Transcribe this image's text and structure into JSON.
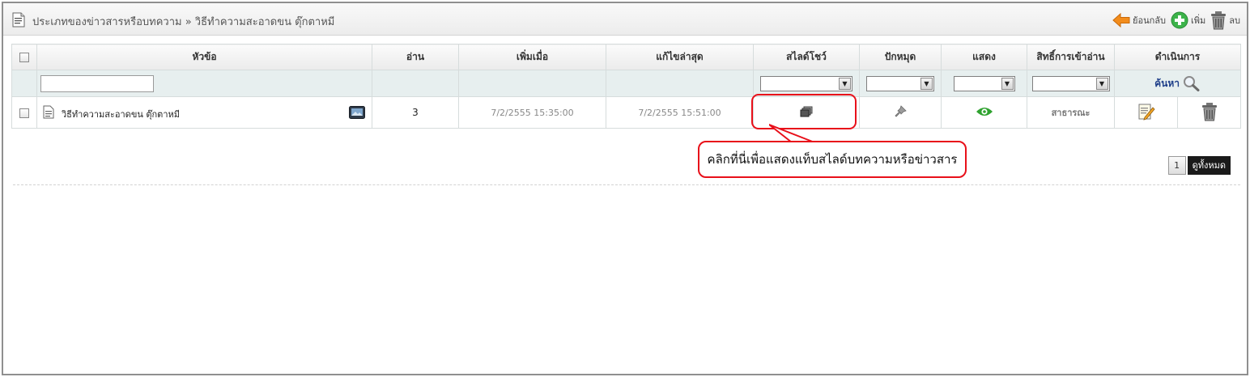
{
  "header": {
    "title": "ประเภทของข่าวสารหรือบทความ » วิธีทำความสะอาดขน ตุ๊กตาหมี",
    "back_label": "ย้อนกลับ",
    "add_label": "เพิ่ม",
    "delete_label": "ลบ"
  },
  "table": {
    "columns": [
      "หัวข้อ",
      "อ่าน",
      "เพิ่มเมื่อ",
      "แก้ไขล่าสุด",
      "สไลด์โชว์",
      "ปักหมุด",
      "แสดง",
      "สิทธิ์การเข้าอ่าน",
      "ดำเนินการ"
    ],
    "filter": {
      "title_value": "",
      "slideshow_value": "",
      "pin_value": "",
      "show_value": "",
      "access_value": "",
      "search_label": "ค้นหา"
    },
    "rows": [
      {
        "title": "วิธีทำความสะอาดขน ตุ๊กตาหมี",
        "reads": "3",
        "added": "7/2/2555 15:35:00",
        "modified": "7/2/2555 15:51:00",
        "access": "สาธารณะ"
      }
    ]
  },
  "annotation": {
    "text": "คลิกที่นี่เพื่อแสดงแท็บสไลด์บทความหรือข่าวสาร",
    "color": "#e8101a"
  },
  "pager": {
    "current_page": "1",
    "view_all_label": "ดูทั้งหมด"
  },
  "colors": {
    "back_arrow": "#f28c1c",
    "add_button": "#3cb34a",
    "show_eye": "#2fa22f",
    "search_link": "#1f3f8a"
  }
}
